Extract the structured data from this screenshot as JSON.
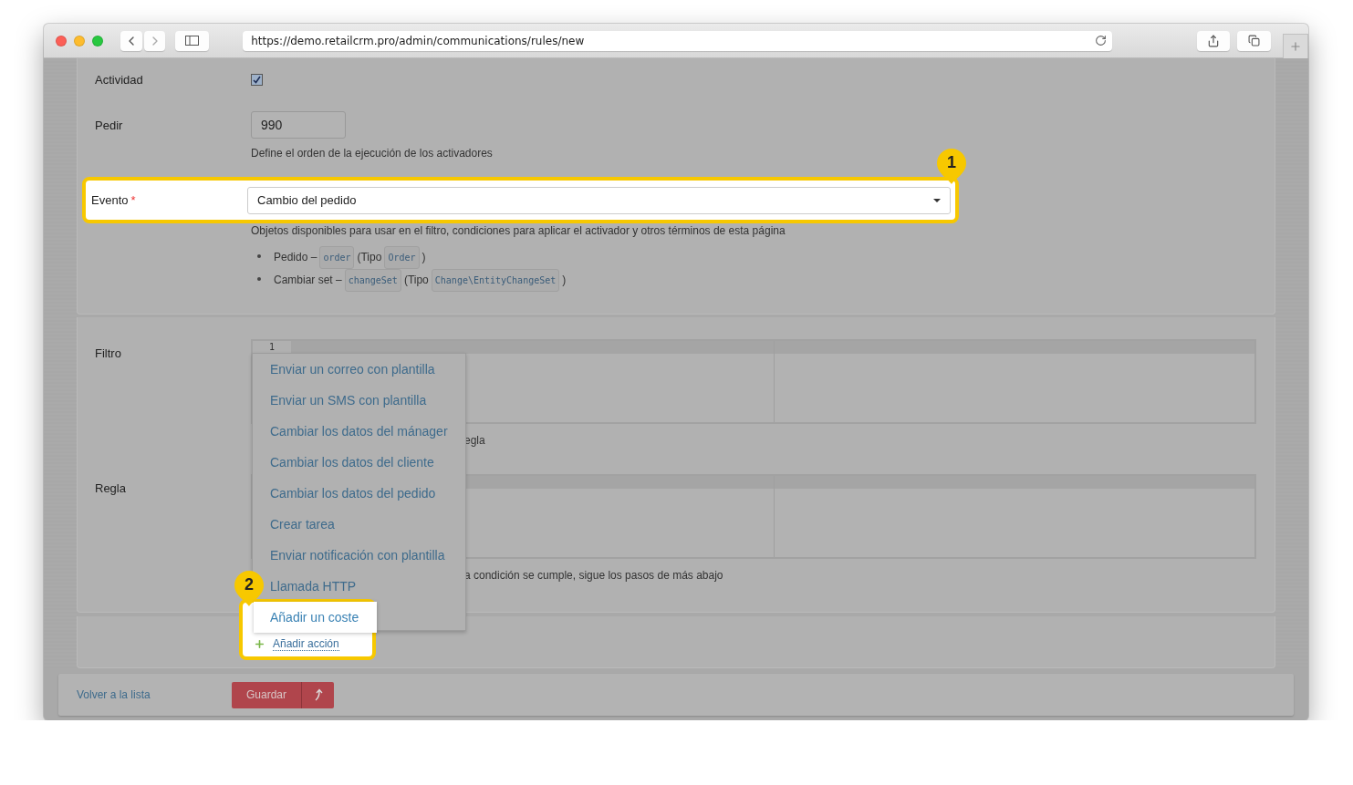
{
  "browser": {
    "url": "https://demo.retailcrm.pro/admin/communications/rules/new"
  },
  "form": {
    "activity": {
      "label": "Actividad",
      "checked": true
    },
    "order": {
      "label": "Pedir",
      "value": "990",
      "hint": "Define el orden de la ejecución de los activadores"
    },
    "event": {
      "label": "Evento",
      "required_mark": "*",
      "value": "Cambio del pedido",
      "badge": "1",
      "hint": "Objetos disponibles para usar en el filtro, condiciones para aplicar el activador y otros términos de esta página",
      "objects": [
        {
          "name": "Pedido –",
          "code": "order",
          "type_prefix": "(Tipo",
          "type": "Order",
          "suffix": ")"
        },
        {
          "name": "Cambiar set –",
          "code": "changeSet",
          "type_prefix": "(Tipo",
          "type": "Change\\EntityChangeSet",
          "suffix": ")"
        }
      ]
    },
    "filter": {
      "label": "Filtro",
      "line_number": "1",
      "hint": "egla"
    },
    "rule": {
      "label": "Regla",
      "hint": "a condición se cumple, sigue los pasos de más abajo"
    }
  },
  "action_menu": {
    "items": [
      {
        "label": "Enviar un correo con plantilla",
        "selected": false
      },
      {
        "label": "Enviar un SMS con plantilla",
        "selected": false
      },
      {
        "label": "Cambiar los datos del mánager",
        "selected": false
      },
      {
        "label": "Cambiar los datos del cliente",
        "selected": false
      },
      {
        "label": "Cambiar los datos del pedido",
        "selected": false
      },
      {
        "label": "Crear tarea",
        "selected": false
      },
      {
        "label": "Enviar notificación con plantilla",
        "selected": false
      },
      {
        "label": "Llamada HTTP",
        "selected": false
      },
      {
        "label": "Añadir un coste",
        "selected": true
      }
    ]
  },
  "add_action": {
    "label": "Añadir acción",
    "badge": "2"
  },
  "footer": {
    "back_link": "Volver a la lista",
    "save_button": "Guardar"
  }
}
